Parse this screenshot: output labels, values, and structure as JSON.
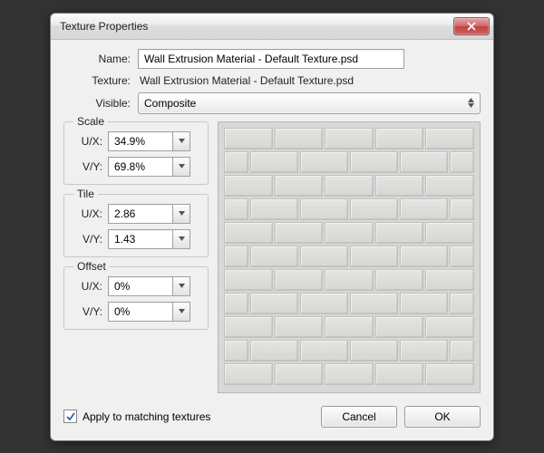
{
  "title": "Texture Properties",
  "labels": {
    "name": "Name:",
    "texture": "Texture:",
    "visible": "Visible:"
  },
  "name_value": "Wall Extrusion Material - Default Texture.psd",
  "texture_value": "Wall Extrusion Material - Default Texture.psd",
  "visible_value": "Composite",
  "scale": {
    "title": "Scale",
    "ux_label": "U/X:",
    "vy_label": "V/Y:",
    "ux": "34.9%",
    "vy": "69.8%"
  },
  "tile": {
    "title": "Tile",
    "ux_label": "U/X:",
    "vy_label": "V/Y:",
    "ux": "2.86",
    "vy": "1.43"
  },
  "offset": {
    "title": "Offset",
    "ux_label": "U/X:",
    "vy_label": "V/Y:",
    "ux": "0%",
    "vy": "0%"
  },
  "apply_label": "Apply to matching textures",
  "apply_checked": true,
  "buttons": {
    "cancel": "Cancel",
    "ok": "OK"
  }
}
